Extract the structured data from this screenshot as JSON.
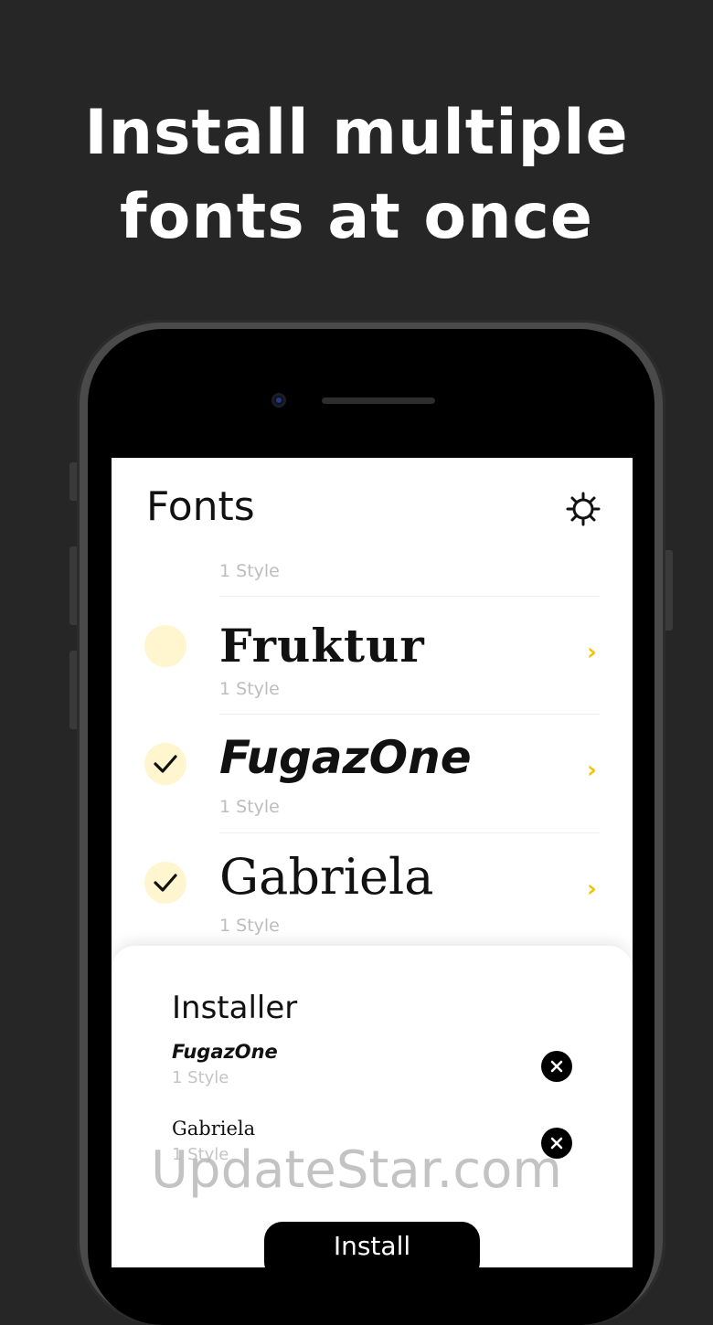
{
  "headline": {
    "line1": "Install multiple",
    "line2": "fonts at once"
  },
  "app": {
    "title": "Fonts",
    "settings_icon": "gear-icon"
  },
  "font_list": {
    "partial_row_style": "1 Style",
    "rows": [
      {
        "name": "Fruktur",
        "style": "1 Style",
        "selected": false,
        "chevron": "›"
      },
      {
        "name": "FugazOne",
        "style": "1 Style",
        "selected": true,
        "chevron": "›"
      },
      {
        "name": "Gabriela",
        "style": "1 Style",
        "selected": true,
        "chevron": "›"
      }
    ]
  },
  "installer": {
    "title": "Installer",
    "items": [
      {
        "name": "FugazOne",
        "style": "1 Style",
        "remove_icon": "close-icon"
      },
      {
        "name": "Gabriela",
        "style": "1 Style",
        "remove_icon": "close-icon"
      }
    ],
    "install_label": "Install"
  },
  "watermark": "UpdateStar.com",
  "colors": {
    "background": "#262626",
    "accent": "#f2c400",
    "selection_circle": "#fff6d0"
  }
}
